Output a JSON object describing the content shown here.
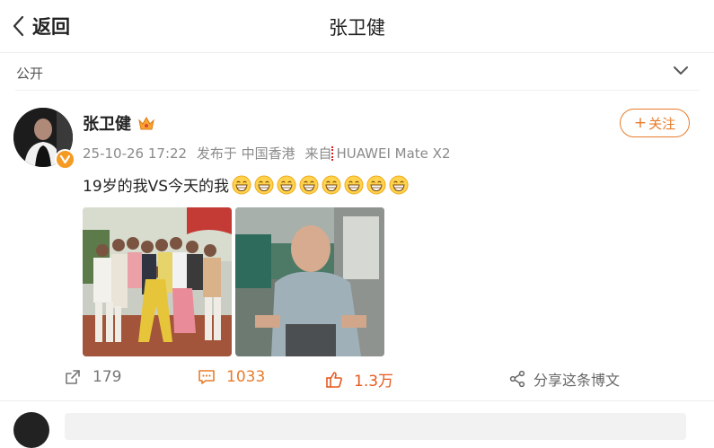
{
  "header": {
    "back_label": "返回",
    "title": "张卫健"
  },
  "visibility": {
    "label": "公开",
    "icon": "chevron-down-icon"
  },
  "author": {
    "name": "张卫健",
    "verified_icon": "verified-v-icon",
    "badge_icon": "crown-icon",
    "follow_label": "关注",
    "follow_icon": "plus-icon"
  },
  "meta": {
    "time": "25-10-26 17:22",
    "location": "发布于 中国香港",
    "source": "来自",
    "device": "HUAWEI Mate X2"
  },
  "post": {
    "text": "19岁的我VS今天的我",
    "emoji_count": 8,
    "emoji_icon": "grin-emoji-icon",
    "images": [
      {
        "label": "group-photo"
      },
      {
        "label": "portrait-photo"
      }
    ]
  },
  "actions": {
    "repost_count": "179",
    "comment_count": "1033",
    "like_count": "1.3万",
    "share_label": "分享这条博文"
  },
  "colors": {
    "accent_orange": "#e87b2b",
    "like_red": "#e55a1f",
    "text_gray": "#8a8a8a"
  }
}
